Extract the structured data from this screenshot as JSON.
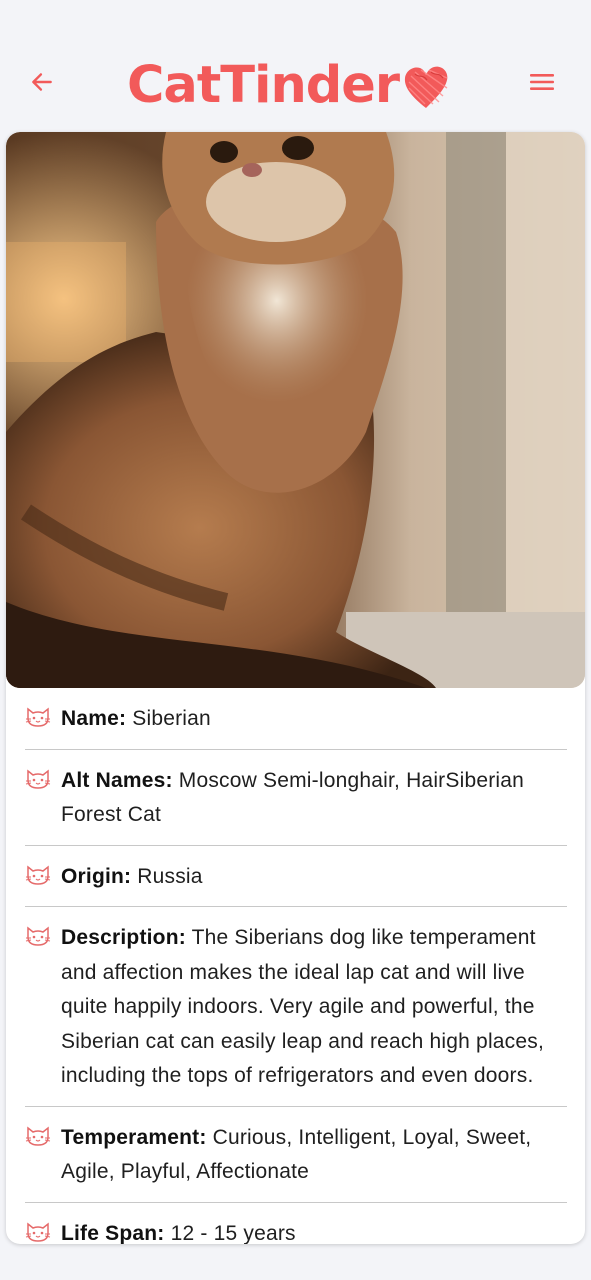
{
  "header": {
    "title": "CatTinder",
    "back_icon": "arrow-left-icon",
    "menu_icon": "hamburger-menu-icon",
    "heart_icon": "heart-icon",
    "accent_color": "#f25a5a"
  },
  "breed": {
    "photo_alt": "cat-photo",
    "rows": [
      {
        "label": "Name:",
        "value": "Siberian",
        "icon": "cat-face-icon"
      },
      {
        "label": "Alt Names:",
        "value": "Moscow Semi-longhair, HairSiberian Forest Cat",
        "icon": "cat-face-icon"
      },
      {
        "label": "Origin:",
        "value": "Russia",
        "icon": "cat-face-icon"
      },
      {
        "label": "Description:",
        "value": "The Siberians dog like temperament and affection makes the ideal lap cat and will live quite happily indoors. Very agile and powerful, the Siberian cat can easily leap and reach high places, including the tops of refrigerators and even doors.",
        "icon": "cat-face-icon"
      },
      {
        "label": "Temperament:",
        "value": "Curious, Intelligent, Loyal, Sweet, Agile, Playful, Affectionate",
        "icon": "cat-face-icon"
      },
      {
        "label": "Life Span:",
        "value": "12 - 15 years",
        "icon": "cat-face-icon"
      }
    ]
  }
}
